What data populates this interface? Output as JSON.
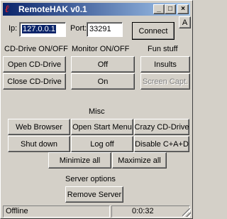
{
  "window": {
    "title": "RemoteHAK v0.1",
    "buttons": {
      "minimize": "_",
      "maximize": "□",
      "close": "×"
    }
  },
  "connection": {
    "ip_label": "Ip:",
    "ip_value": "127.0.0.1",
    "port_label": "Port:",
    "port_value": "33291",
    "connect_label": "Connect",
    "a_label": "A"
  },
  "sections": {
    "cd": {
      "title": "CD-Drive ON/OFF",
      "open": "Open CD-Drive",
      "close": "Close CD-Drive"
    },
    "monitor": {
      "title": "Monitor ON/OFF",
      "off": "Off",
      "on": "On"
    },
    "fun": {
      "title": "Fun stuff",
      "insults": "Insults",
      "screen_capt": "Screen Capt."
    },
    "misc": {
      "title": "Misc",
      "web_browser": "Web Browser",
      "open_start_menu": "Open Start Menu",
      "crazy_cd": "Crazy CD-Drive",
      "shut_down": "Shut down",
      "log_off": "Log off",
      "disable_cad": "Disable C+A+D",
      "minimize_all": "Minimize all",
      "maximize_all": "Maximize all"
    },
    "server": {
      "title": "Server options",
      "remove_server": "Remove Server"
    }
  },
  "status": {
    "state": "Offline",
    "time": "0:0:32"
  },
  "colors": {
    "titlebar_start": "#0a246a",
    "titlebar_end": "#a6caf0",
    "face": "#d4d0c8",
    "selection": "#0a246a"
  }
}
